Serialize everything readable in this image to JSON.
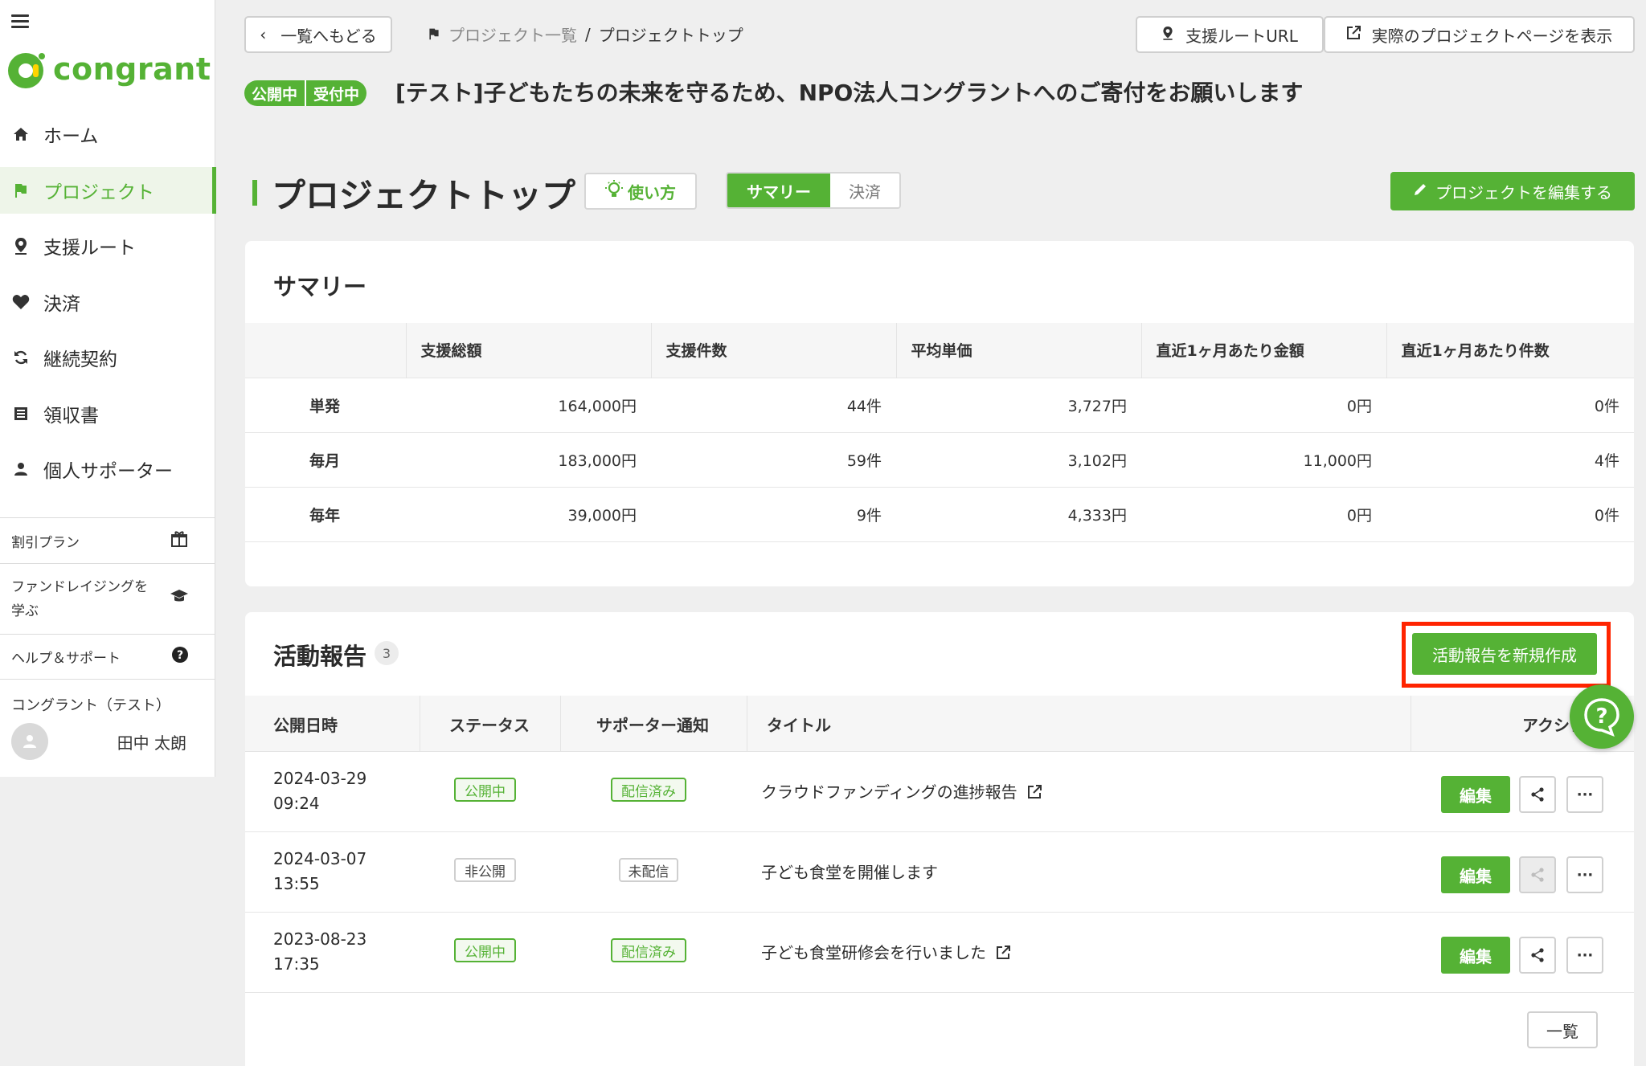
{
  "sidebar": {
    "brand": "congrant",
    "nav": [
      {
        "label": "ホーム",
        "icon": "home-icon"
      },
      {
        "label": "プロジェクト",
        "icon": "flag-icon"
      },
      {
        "label": "支援ルート",
        "icon": "location-pin-icon"
      },
      {
        "label": "決済",
        "icon": "heart-icon"
      },
      {
        "label": "継続契約",
        "icon": "refresh-icon"
      },
      {
        "label": "領収書",
        "icon": "receipt-icon"
      },
      {
        "label": "個人サポーター",
        "icon": "person-icon"
      }
    ],
    "active_index": 1,
    "sub": [
      {
        "label": "割引プラン",
        "icon": "gift-icon"
      },
      {
        "label_line1": "ファンドレイジングを",
        "label_line2": "学ぶ",
        "icon": "graduation-cap-icon"
      },
      {
        "label": "ヘルプ＆サポート",
        "icon": "question-circle-icon"
      }
    ],
    "user": {
      "org": "コングラント（テスト）",
      "name": "田中 太朗"
    }
  },
  "header": {
    "back_label": "一覧へもどる",
    "breadcrumb_parent": "プロジェクト一覧",
    "breadcrumb_sep": "/",
    "breadcrumb_current": "プロジェクトトップ",
    "route_url_label": "支援ルートURL",
    "view_page_label": "実際のプロジェクトページを表示",
    "badge_public": "公開中",
    "badge_accepting": "受付中",
    "project_title": "[テスト]子どもたちの未来を守るため、NPO法人コングラントへのご寄付をお願いします"
  },
  "page": {
    "heading": "プロジェクトトップ",
    "howto_label": "使い方",
    "tab_summary": "サマリー",
    "tab_payment": "決済",
    "edit_project_label": "プロジェクトを編集する"
  },
  "summary": {
    "title": "サマリー",
    "columns": [
      "",
      "支援総額",
      "支援件数",
      "平均単価",
      "直近1ヶ月あたり金額",
      "直近1ヶ月あたり件数"
    ],
    "rows": [
      [
        "単発",
        "164,000円",
        "44件",
        "3,727円",
        "0円",
        "0件"
      ],
      [
        "毎月",
        "183,000円",
        "59件",
        "3,102円",
        "11,000円",
        "4件"
      ],
      [
        "毎年",
        "39,000円",
        "9件",
        "4,333円",
        "0円",
        "0件"
      ]
    ]
  },
  "activity": {
    "title": "活動報告",
    "count": "3",
    "new_label": "活動報告を新規作成",
    "columns": {
      "date": "公開日時",
      "status": "ステータス",
      "notify": "サポーター通知",
      "title": "タイトル",
      "action": "アクション"
    },
    "rows": [
      {
        "date": "2024-03-29",
        "time": "09:24",
        "status": "公開中",
        "notify": "配信済み",
        "title": "クラウドファンディングの進捗報告",
        "status_color": "#55b235",
        "external": true,
        "share_enabled": true
      },
      {
        "date": "2024-03-07",
        "time": "13:55",
        "status": "非公開",
        "notify": "未配信",
        "title": "子ども食堂を開催します",
        "status_color": "#888888",
        "external": false,
        "share_enabled": false
      },
      {
        "date": "2023-08-23",
        "time": "17:35",
        "status": "公開中",
        "notify": "配信済み",
        "title": "子ども食堂研修会を行いました",
        "status_color": "#55b235",
        "external": true,
        "share_enabled": true
      }
    ],
    "edit_label": "編集",
    "more_label": "···",
    "list_label": "一覧"
  },
  "colors": {
    "brand": "#55b235",
    "highlight": "#ff2400",
    "background": "#efefef"
  }
}
